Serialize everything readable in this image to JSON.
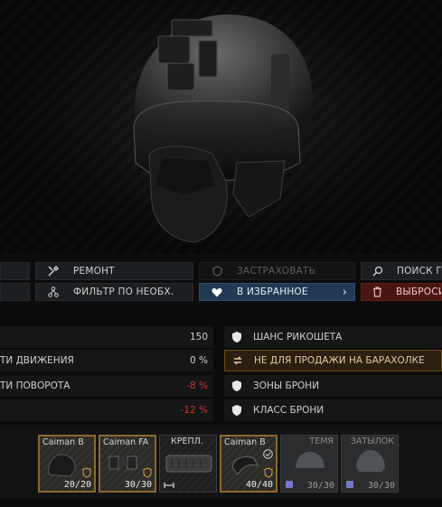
{
  "actions": {
    "row1": [
      {
        "label": "",
        "icon": "none",
        "disabled": false
      },
      {
        "label": "РЕМОНТ",
        "icon": "repair-tools-icon",
        "disabled": false
      },
      {
        "label": "ЗАСТРАХОВАТЬ",
        "icon": "shield-outline-icon",
        "disabled": true
      },
      {
        "label": "ПОИСК ПО",
        "icon": "magnifier-icon",
        "disabled": false
      }
    ],
    "row2": [
      {
        "label": "",
        "icon": "none",
        "disabled": false
      },
      {
        "label": "ФИЛЬТР ПО НЕОБХ.",
        "icon": "filter-nodes-icon",
        "disabled": false
      },
      {
        "label": "В ИЗБРАННОЕ",
        "icon": "heart-icon",
        "disabled": false,
        "chevron": "›"
      },
      {
        "label": "ВЫБРОСИ",
        "icon": "trash-icon",
        "disabled": false
      }
    ]
  },
  "stats_left": [
    {
      "label": "",
      "value": "150",
      "negative": false
    },
    {
      "label": "ТИ ДВИЖЕНИЯ",
      "value": "0 %",
      "negative": false
    },
    {
      "label": "ТИ ПОВОРОТА",
      "value": "-8 %",
      "negative": true
    },
    {
      "label": "",
      "value": "-12 %",
      "negative": true
    }
  ],
  "stats_right": [
    {
      "label": "ШАНС РИКОШЕТА",
      "icon": "shield-icon"
    },
    {
      "label": "НЕ ДЛЯ ПРОДАЖИ НА БАРАХОЛКЕ",
      "icon": "exchange-arrows-icon",
      "warning": true
    },
    {
      "label": "ЗОНЫ БРОНИ",
      "icon": "shield-icon"
    },
    {
      "label": "КЛАСС БРОНИ",
      "icon": "shield-icon"
    }
  ],
  "slots": [
    {
      "name": "Caiman B",
      "durability": "20/20",
      "kind": "filled"
    },
    {
      "name": "Caiman FA",
      "durability": "30/30",
      "kind": "filled"
    },
    {
      "name": "КРЕПЛ.",
      "durability": "",
      "kind": "mount"
    },
    {
      "name": "Caiman B",
      "durability": "40/40",
      "kind": "filled",
      "checked": true
    },
    {
      "name": "ТЕМЯ",
      "durability": "30/30",
      "kind": "empty"
    },
    {
      "name": "ЗАТЫЛОК",
      "durability": "30/30",
      "kind": "empty"
    }
  ],
  "colors": {
    "favorite": "#1f3a52",
    "discard": "#4a1614",
    "negative": "#c23a32",
    "warning_border": "#6b4a1c",
    "slot_border": "#8a6a2c"
  }
}
